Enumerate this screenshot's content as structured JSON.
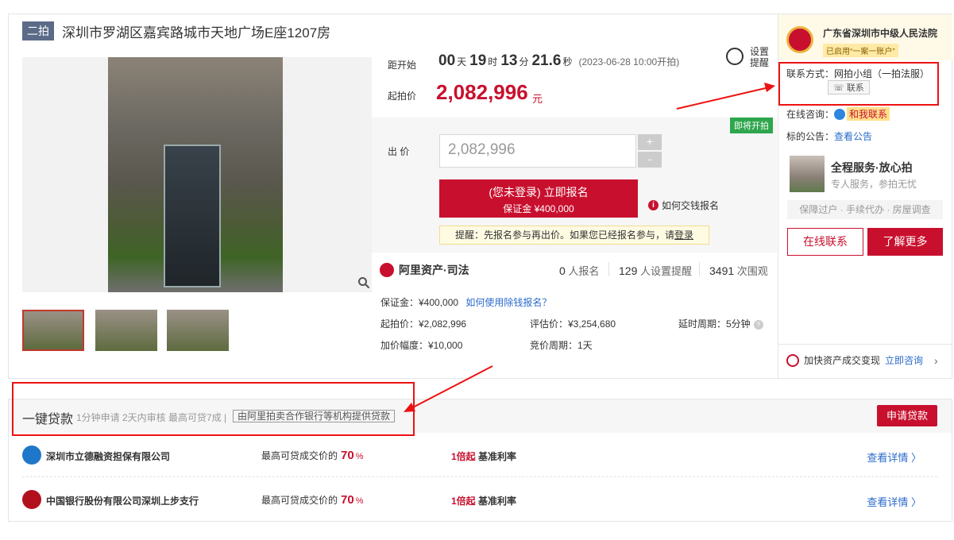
{
  "title": {
    "round_tag": "二拍",
    "text": "深圳市罗湖区嘉宾路城市天地广场E座1207房"
  },
  "countdown": {
    "label": "距开始",
    "days": "00",
    "days_unit": "天",
    "hours": "19",
    "hours_unit": "时",
    "minutes": "13",
    "minutes_unit": "分",
    "seconds": "21.6",
    "seconds_unit": "秒",
    "start_note": "(2023-06-28 10:00开拍)",
    "remind_label_1": "设置",
    "remind_label_2": "提醒"
  },
  "start_price": {
    "label": "起拍价",
    "value": "2,082,996",
    "unit": "元"
  },
  "bid": {
    "status_tag": "即将开拍",
    "label": "出 价",
    "input_value": "2,082,996",
    "plus": "+",
    "minus": "-",
    "signup_line1": "(您未登录) 立即报名",
    "signup_line2": "保证金 ¥400,000",
    "how_link": "如何交钱报名",
    "tip_prefix": "提醒：先报名参与再出价。如果您已经报名参与，请",
    "tip_link": "登录"
  },
  "ali": {
    "logo": "阿里资产·司法",
    "stats": [
      {
        "value": "0",
        "label": "人报名"
      },
      {
        "value": "129",
        "label": "人设置提醒"
      },
      {
        "value": "3491",
        "label": "次围观"
      }
    ],
    "deposit_label": "保证金：¥400,000",
    "deposit_link": "如何使用除钱报名？",
    "start_price": "起拍价：¥2,082,996",
    "assessed": "评估价：¥3,254,680",
    "delay": "延时周期：5分钟",
    "increment": "加价幅度：¥10,000",
    "period": "竞价周期：1天"
  },
  "sidebar": {
    "court_name": "广东省深圳市中级人民法院",
    "court_badge": "已启用“一案一账户”",
    "contact_label": "联系方式：网拍小组（一拍法服）",
    "contact_button": "联系",
    "online_consult_label": "在线咨询：",
    "online_consult_badge": "和我联系",
    "notice_label": "标的公告：",
    "notice_link": "查看公告",
    "service_title": "全程服务·放心拍",
    "service_sub": "专人服务，参拍无忧",
    "service_bar": "保障过户 · 手续代办 · 房屋调查",
    "btn_online": "在线联系",
    "btn_more": "了解更多",
    "speed_text": "加快资产成交变现",
    "speed_link": "立即咨询",
    "speed_chevron": "›"
  },
  "loan": {
    "title": "一键贷款",
    "subtitle": "1分钟申请 2天内审核 最高可贷7成 |",
    "provider": "由阿里拍卖合作银行等机构提供贷款",
    "apply_button": "申请贷款",
    "banks": [
      {
        "name": "深圳市立德融资担保有限公司",
        "ratio_label": "最高可贷成交价的",
        "ratio_value": "70",
        "ratio_unit": "%",
        "rate_highlight": "1倍起",
        "rate_label": "基准利率",
        "detail": "查看详情 〉",
        "logo_color": "#1f77c9"
      },
      {
        "name": "中国银行股份有限公司深圳上步支行",
        "ratio_label": "最高可贷成交价的",
        "ratio_value": "70",
        "ratio_unit": "%",
        "rate_highlight": "1倍起",
        "rate_label": "基准利率",
        "detail": "查看详情 〉",
        "logo_color": "#b3101e"
      }
    ]
  },
  "colors": {
    "accent_red": "#c8102e",
    "link_blue": "#2a6bcb",
    "annotation_red": "#ee1111"
  }
}
